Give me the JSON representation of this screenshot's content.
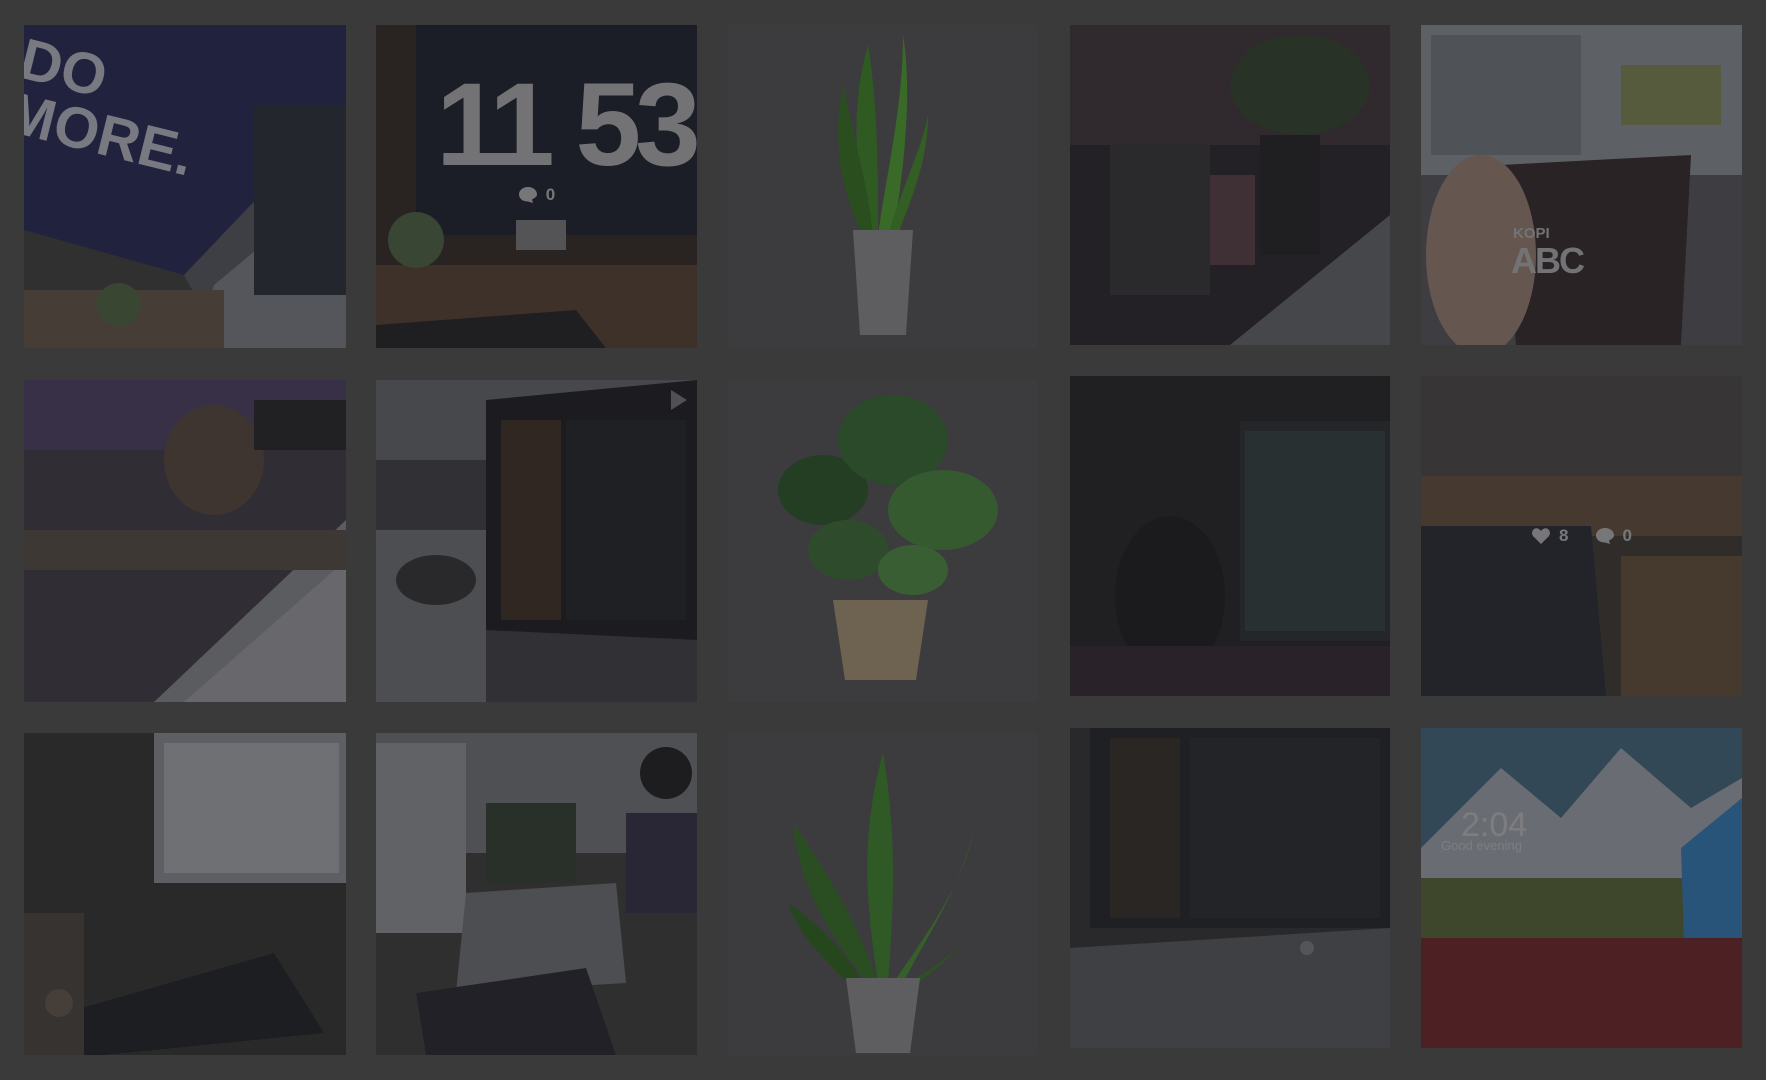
{
  "tiles": {
    "t1": {
      "overlay_text": "DO\nMORE."
    },
    "t2": {
      "clock_text": "11 53",
      "comments": "0"
    },
    "t5": {
      "mug_brand": "KOPI",
      "mug_text": "ABC"
    },
    "t10": {
      "likes": "8",
      "comments": "0"
    },
    "t15": {
      "lock_time": "2:04",
      "lock_greeting": "Good evening"
    }
  },
  "colors": {
    "page_bg": "#3a3a3a",
    "overlay": "#28282c"
  },
  "icons": [
    "heart-icon",
    "comment-icon",
    "play-icon"
  ]
}
